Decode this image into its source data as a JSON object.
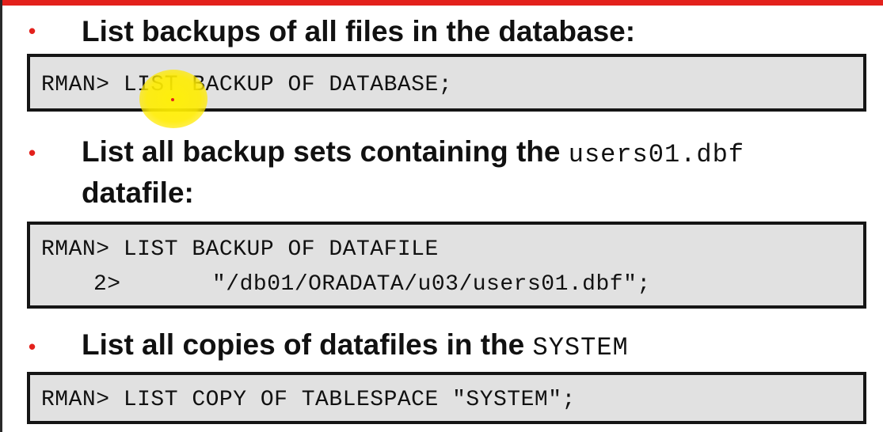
{
  "slide": {
    "bullet_char": "•",
    "items": [
      {
        "text": "List backups of all files in the database:",
        "code_lines": [
          "RMAN> LIST BACKUP OF DATABASE;"
        ]
      },
      {
        "text_prefix": "List all backup sets containing the",
        "text_mono": "users01.dbf",
        "text_line2": "datafile:",
        "code_lines": [
          "RMAN> LIST BACKUP OF DATAFILE",
          "2>",
          "\"/db01/ORADATA/u03/users01.dbf\";"
        ]
      },
      {
        "text_prefix": "List all copies of datafiles in the",
        "text_mono": "SYSTEM",
        "code_lines": [
          "RMAN> LIST COPY OF TABLESPACE \"SYSTEM\";"
        ]
      }
    ]
  },
  "colors": {
    "accent": "#e3211c",
    "code_background": "#e1e1e1",
    "pointer": "#ffef00"
  },
  "icons": {
    "pointer": "mouse-pointer-highlight-icon"
  }
}
